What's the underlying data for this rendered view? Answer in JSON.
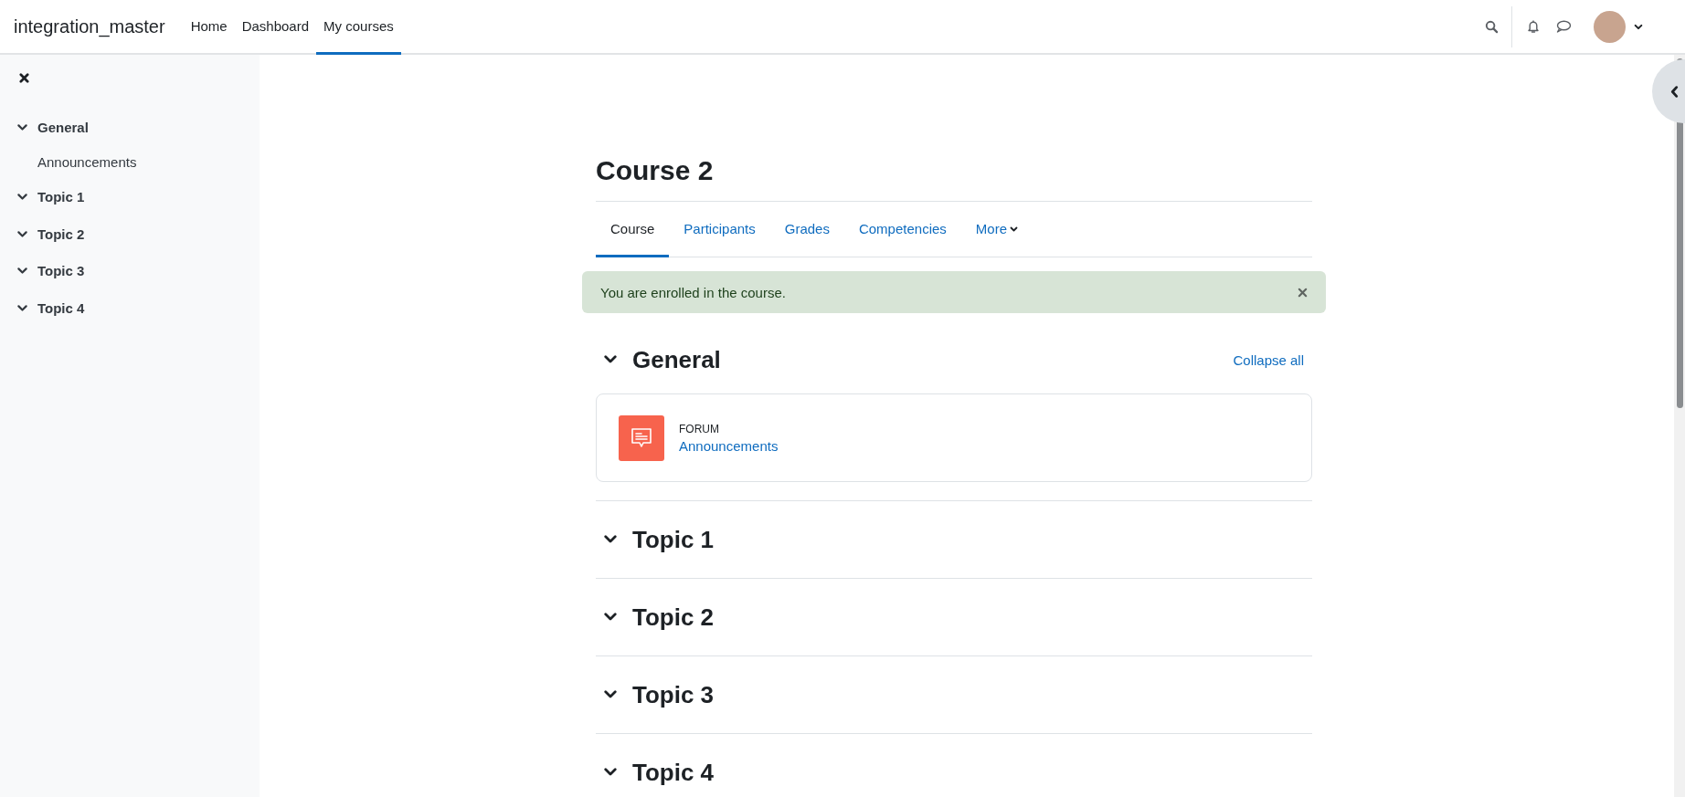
{
  "navbar": {
    "brand": "integration_master",
    "links": [
      {
        "label": "Home",
        "selected": false
      },
      {
        "label": "Dashboard",
        "selected": false
      },
      {
        "label": "My courses",
        "selected": true
      }
    ]
  },
  "sidebar": {
    "items": [
      {
        "label": "General",
        "expanded": true,
        "children": [
          {
            "label": "Announcements"
          }
        ]
      },
      {
        "label": "Topic 1",
        "expanded": true
      },
      {
        "label": "Topic 2",
        "expanded": true
      },
      {
        "label": "Topic 3",
        "expanded": true
      },
      {
        "label": "Topic 4",
        "expanded": true
      }
    ]
  },
  "course": {
    "title": "Course 2",
    "tabs": [
      {
        "label": "Course",
        "selected": true,
        "kind": "link"
      },
      {
        "label": "Participants",
        "selected": false,
        "kind": "link"
      },
      {
        "label": "Grades",
        "selected": false,
        "kind": "link"
      },
      {
        "label": "Competencies",
        "selected": false,
        "kind": "link"
      },
      {
        "label": "More",
        "selected": false,
        "kind": "dropdown"
      }
    ],
    "alert": "You are enrolled in the course.",
    "collapse_all": "Collapse all",
    "sections": [
      {
        "title": "General",
        "expanded": true,
        "activities": [
          {
            "type": "FORUM",
            "name": "Announcements"
          }
        ]
      },
      {
        "title": "Topic 1",
        "expanded": true
      },
      {
        "title": "Topic 2",
        "expanded": true
      },
      {
        "title": "Topic 3",
        "expanded": true
      },
      {
        "title": "Topic 4",
        "expanded": true
      }
    ]
  }
}
